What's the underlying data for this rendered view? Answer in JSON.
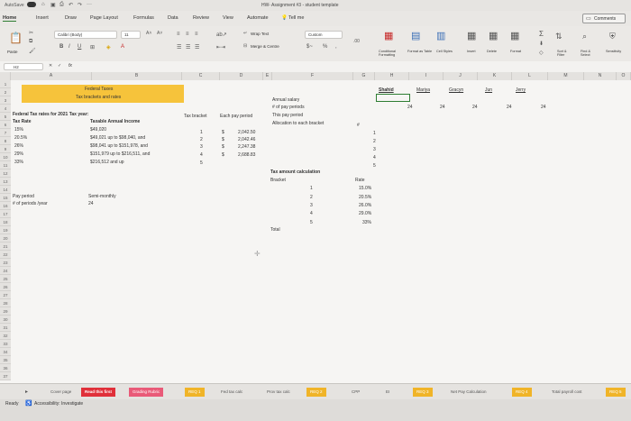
{
  "titlebar": {
    "autosave": "AutoSave",
    "doc_title": "HW- Assignment #3 - student template"
  },
  "ribbon_tabs": [
    "Home",
    "Insert",
    "Draw",
    "Page Layout",
    "Formulas",
    "Data",
    "Review",
    "View",
    "Automate"
  ],
  "tell_me": "Tell me",
  "comments": "Comments",
  "ribbon": {
    "paste": "Paste",
    "font_name": "Calibri (Body)",
    "font_size": "11",
    "wrap_text": "Wrap Text",
    "merge_center": "Merge & Centre",
    "number_format": "Custom",
    "conditional": "Conditional Formatting",
    "format_table": "Format as Table",
    "cell_styles": "Cell Styles",
    "insert": "Insert",
    "delete": "Delete",
    "format": "Format",
    "sort_filter": "Sort & Filter",
    "find_select": "Find & Select",
    "sensitivity": "Sensitivity"
  },
  "formula_bar": {
    "name_box": "H2",
    "fx": "fx",
    "content": ""
  },
  "columns": [
    "A",
    "B",
    "C",
    "D",
    "E",
    "F",
    "G",
    "H",
    "I",
    "J",
    "K",
    "L",
    "M",
    "N",
    "O"
  ],
  "rows": [
    "1",
    "2",
    "3",
    "4",
    "5",
    "6",
    "7",
    "8",
    "9",
    "10",
    "11",
    "12",
    "13",
    "14",
    "15",
    "16",
    "17",
    "18",
    "19",
    "20",
    "21",
    "22",
    "23",
    "24",
    "25",
    "26",
    "27",
    "28",
    "29",
    "30",
    "31",
    "32",
    "33",
    "34",
    "35",
    "36",
    "37"
  ],
  "sheet": {
    "header1": "Federal Taxes",
    "header2": "Tax brackets and rates",
    "fed_rates_title": "Federal Tax rates for 2021 Tax year:",
    "tax_rate_hdr": "Tax Rate",
    "taxable_hdr": "Taxable Annual Income",
    "rates": [
      "15%",
      "20.5%",
      "26%",
      "29%",
      "33%"
    ],
    "incomes": [
      "$49,020",
      "$49,021 up to $98,040, and",
      "$98,041 up to $151,978, and",
      "$151,979 up to $216,511, and",
      "$216,512 and up"
    ],
    "tax_bracket_hdr": "Tax bracket",
    "each_pay_hdr": "Each pay period",
    "brackets": [
      "1",
      "2",
      "3",
      "4",
      "5"
    ],
    "dollar": "$",
    "pay_amounts": [
      "2,042.50",
      "2,042.46",
      "2,247.38",
      "2,688.83"
    ],
    "annual_salary": "Annual salary",
    "num_pay_periods": "# of pay periods",
    "this_pay_period": "This pay period",
    "allocation": "Allocation to each bracket",
    "hash": "#",
    "alloc_nums": [
      "1",
      "2",
      "3",
      "4",
      "5"
    ],
    "pay_period_lbl": "Pay period",
    "periods_per_year_lbl": "# of periods /year",
    "semi_monthly": "Semi-monthly",
    "periods_value": "24",
    "tax_calc_title": "Tax amount calculation",
    "bracket_hdr": "Bracket",
    "rate_hdr": "Rate",
    "calc_brackets": [
      "1",
      "2",
      "3",
      "4",
      "5"
    ],
    "calc_rates": [
      "15.0%",
      "20.5%",
      "26.0%",
      "29.0%",
      "33%"
    ],
    "total": "Total",
    "names": [
      "Shahid",
      "Mariya",
      "Gracyn",
      "Jun",
      "Jerry"
    ],
    "periods_row": [
      "24",
      "24",
      "24",
      "24",
      "24"
    ]
  },
  "sheet_tabs": [
    "Cover page",
    "Read this first",
    "Grading Rubric",
    "REQ 1",
    "Fed tax calc",
    "Prov tax calc",
    "REQ 2",
    "CPP",
    "EI",
    "REQ 3",
    "Net Pay Calculation",
    "REQ 4",
    "Total payroll cost",
    "REQ 5"
  ],
  "status": {
    "ready": "Ready",
    "accessibility": "Accessibility: Investigate"
  },
  "colors": {
    "highlight": "#f6c33b",
    "req_tab": "#f0b428",
    "red_tab": "#e0303a",
    "pink_tab": "#e95a78"
  }
}
